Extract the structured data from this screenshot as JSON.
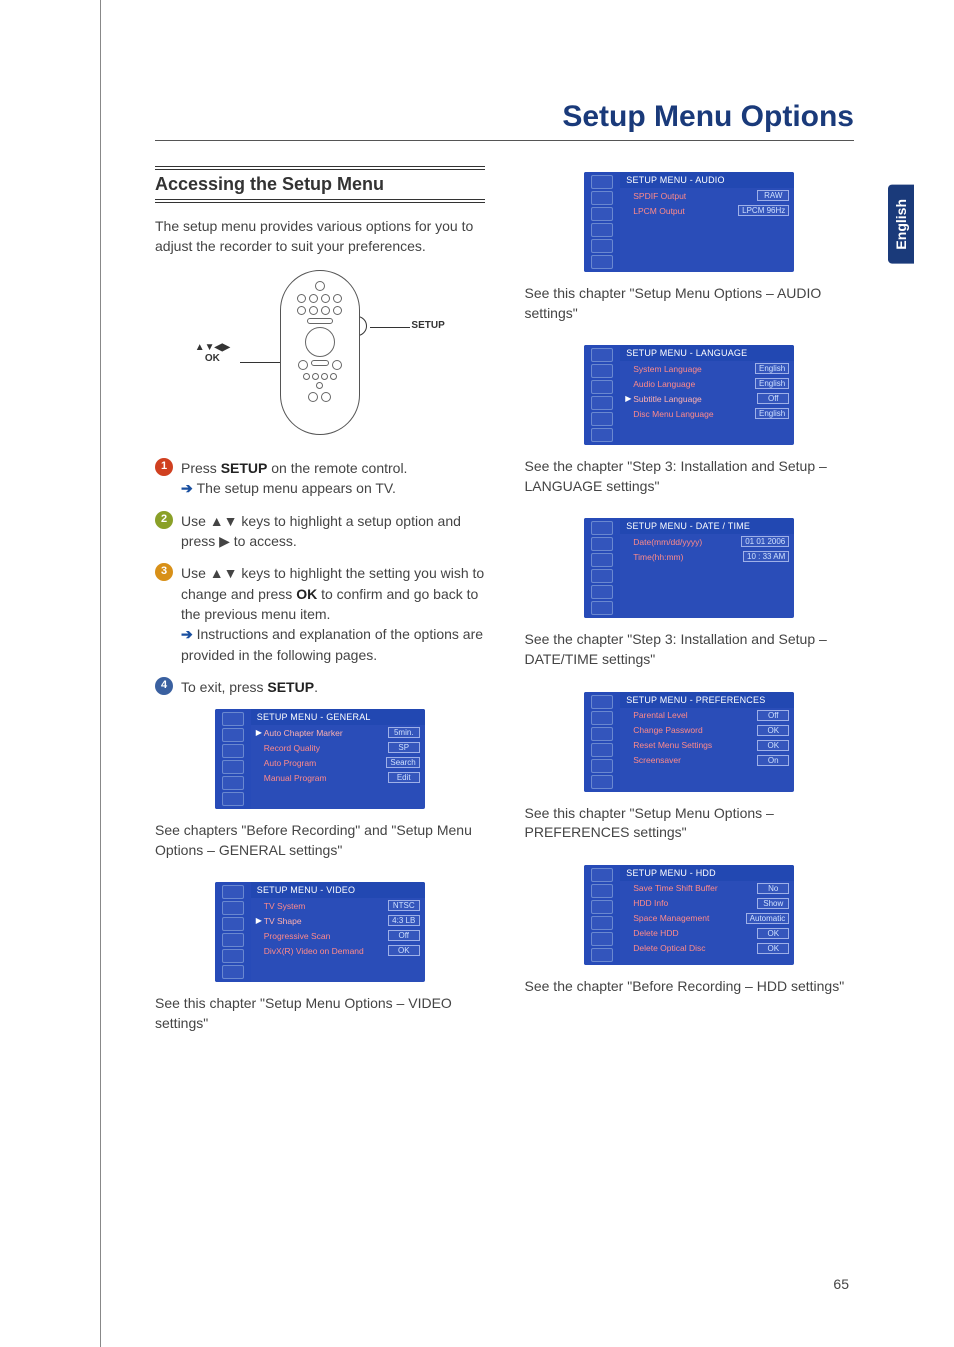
{
  "page_title": "Setup Menu Options",
  "language_tab": "English",
  "page_number": "65",
  "section_heading": "Accessing the Setup Menu",
  "intro": "The setup menu provides various options for you to adjust the recorder to suit your preferences.",
  "remote_labels": {
    "nav": "▲▼◀▶",
    "ok": "OK",
    "setup": "SETUP"
  },
  "steps": {
    "s1a": "Press ",
    "s1b": "SETUP",
    "s1c": " on the remote control.",
    "s1r": "The setup menu appears on TV.",
    "s2a": "Use ",
    "s2b": " keys to highlight a setup option and press ",
    "s2c": " to access.",
    "s3a": "Use ",
    "s3b": " keys to highlight the setting you wish to change and press ",
    "s3c": " to confirm and go back to the previous menu item.",
    "s3r": "Instructions and explanation of the options are provided in the following pages.",
    "s4a": "To exit, press ",
    "s4b": "SETUP",
    "s4c": "."
  },
  "sym": {
    "updown": "▲▼",
    "right": "▶",
    "ok": "OK"
  },
  "menus": {
    "general": {
      "title": "SETUP MENU - GENERAL",
      "rows": [
        {
          "label": "Auto Chapter Marker",
          "value": "5min.",
          "sel": true
        },
        {
          "label": "Record Quality",
          "value": "SP"
        },
        {
          "label": "Auto Program",
          "value": "Search"
        },
        {
          "label": "Manual Program",
          "value": "Edit"
        }
      ],
      "hand_row": 0,
      "caption": "See chapters \"Before Recording\" and \"Setup Menu Options – GENERAL settings\""
    },
    "video": {
      "title": "SETUP MENU - VIDEO",
      "rows": [
        {
          "label": "TV System",
          "value": "NTSC"
        },
        {
          "label": "TV Shape",
          "value": "4:3 LB",
          "sel": true
        },
        {
          "label": "Progressive Scan",
          "value": "Off"
        },
        {
          "label": "DivX(R) Video on Demand",
          "value": "OK"
        }
      ],
      "hand_row": 1,
      "caption": "See this chapter \"Setup Menu Options – VIDEO settings\""
    },
    "audio": {
      "title": "SETUP MENU - AUDIO",
      "rows": [
        {
          "label": "SPDIF Output",
          "value": "RAW"
        },
        {
          "label": "LPCM Output",
          "value": "LPCM 96Hz"
        }
      ],
      "hand_row": 2,
      "caption": "See this chapter \"Setup Menu Options – AUDIO settings\""
    },
    "language": {
      "title": "SETUP MENU - LANGUAGE",
      "rows": [
        {
          "label": "System Language",
          "value": "English"
        },
        {
          "label": "Audio Language",
          "value": "English"
        },
        {
          "label": "Subtitle Language",
          "value": "Off",
          "sel": true
        },
        {
          "label": "Disc Menu Language",
          "value": "English"
        }
      ],
      "hand_row": 3,
      "caption": "See the chapter \"Step 3: Installation and Setup –  LANGUAGE settings\""
    },
    "datetime": {
      "title": "SETUP MENU - DATE / TIME",
      "rows": [
        {
          "label": "Date(mm/dd/yyyy)",
          "value": "01 01 2006"
        },
        {
          "label": "Time(hh:mm)",
          "value": "10 : 33 AM"
        }
      ],
      "hand_row": 4,
      "caption": "See the chapter \"Step 3: Installation and Setup – DATE/TIME settings\""
    },
    "preferences": {
      "title": "SETUP MENU - PREFERENCES",
      "rows": [
        {
          "label": "Parental Level",
          "value": "Off"
        },
        {
          "label": "Change Password",
          "value": "OK"
        },
        {
          "label": "Reset Menu Settings",
          "value": "OK"
        },
        {
          "label": "Screensaver",
          "value": "On"
        }
      ],
      "hand_row": 4,
      "caption": "See this chapter \"Setup Menu Options – PREFERENCES settings\""
    },
    "hdd": {
      "title": "SETUP MENU - HDD",
      "rows": [
        {
          "label": "Save Time Shift Buffer",
          "value": "No"
        },
        {
          "label": "HDD Info",
          "value": "Show"
        },
        {
          "label": "Space Management",
          "value": "Automatic"
        },
        {
          "label": "Delete HDD",
          "value": "OK"
        },
        {
          "label": "Delete Optical Disc",
          "value": "OK"
        }
      ],
      "hand_row": 5,
      "caption": "See the chapter \"Before Recording – HDD settings\""
    }
  }
}
